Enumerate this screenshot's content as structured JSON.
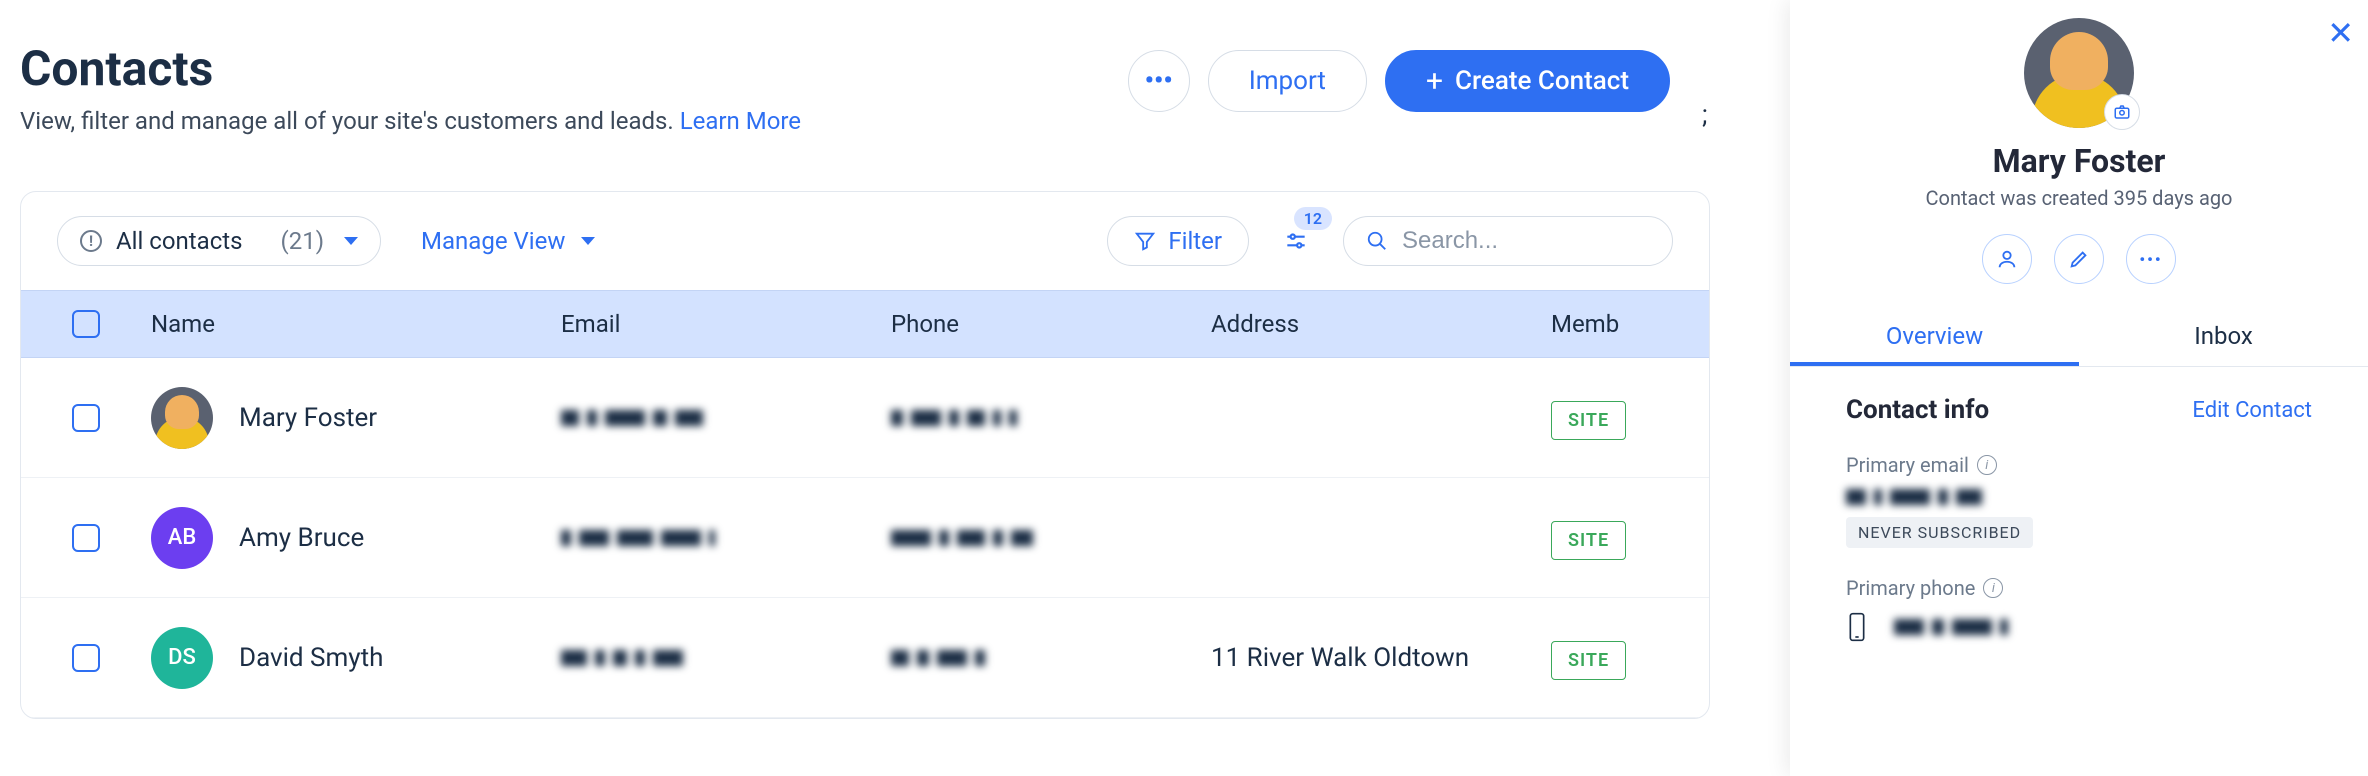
{
  "header": {
    "title": "Contacts",
    "subtitle": "View, filter and manage all of your site's customers and leads. ",
    "learn_more": "Learn More",
    "more_button": "•••",
    "import_label": "Import",
    "create_label": "Create Contact",
    "stray": ";"
  },
  "toolbar": {
    "filter_name": "All contacts",
    "count": "(21)",
    "manage_view": "Manage View",
    "filter_label": "Filter",
    "slider_badge": "12",
    "search_placeholder": "Search..."
  },
  "table": {
    "headers": {
      "name": "Name",
      "email": "Email",
      "phone": "Phone",
      "address": "Address",
      "member": "Memb"
    },
    "rows": [
      {
        "name": "Mary Foster",
        "avatar_type": "photo",
        "initials": "",
        "avatar_class": "avatar-mary",
        "email_redacted": true,
        "phone_redacted": true,
        "address": "",
        "badge": "SITE"
      },
      {
        "name": "Amy Bruce",
        "avatar_type": "initials",
        "initials": "AB",
        "avatar_class": "avatar-ab",
        "email_redacted": true,
        "phone_redacted": true,
        "address": "",
        "badge": "SITE"
      },
      {
        "name": "David Smyth",
        "avatar_type": "initials",
        "initials": "DS",
        "avatar_class": "avatar-ds",
        "email_redacted": true,
        "phone_redacted": true,
        "address": "11 River Walk Oldtown",
        "badge": "SITE"
      }
    ]
  },
  "panel": {
    "name": "Mary Foster",
    "subtitle": "Contact was created 395 days ago",
    "tabs": {
      "overview": "Overview",
      "inbox": "Inbox"
    },
    "section_title": "Contact info",
    "edit_label": "Edit Contact",
    "primary_email_label": "Primary email",
    "subscription_chip": "NEVER SUBSCRIBED",
    "primary_phone_label": "Primary phone"
  }
}
